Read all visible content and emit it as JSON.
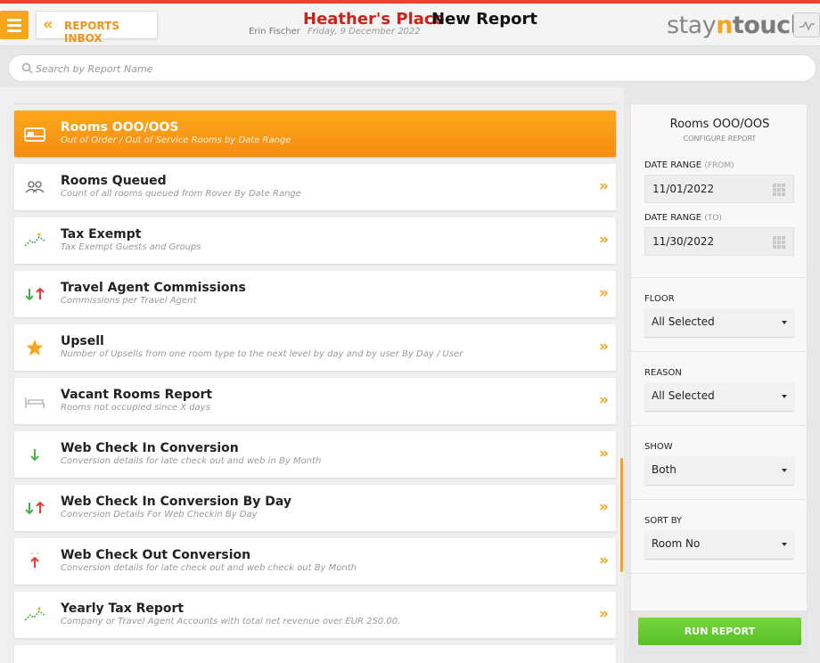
{
  "header": {
    "menu_icon": "hamburger-icon",
    "inbox_label": "REPORTS INBOX",
    "hotel_name": "Heather's Place",
    "page_title": "New Report",
    "user_name": "Erin Fischer",
    "date": "Friday, 9 December 2022",
    "logo_stay": "stay",
    "logo_n": "n",
    "logo_touch": "touch",
    "colors": {
      "accent": "#f7a41d",
      "hotel": "#c8241b",
      "topline": "#e8452f"
    }
  },
  "search": {
    "placeholder": "Search by Report Name",
    "value": ""
  },
  "reports": [
    {
      "title": "Rooms OOO/OOS",
      "desc": "Out of Order / Out of Service Rooms by Date Range",
      "icon": "bed-icon",
      "active": true
    },
    {
      "title": "Rooms Queued",
      "desc": "Count of all rooms queued from Rover By Date Range",
      "icon": "guests-icon",
      "active": false
    },
    {
      "title": "Tax Exempt",
      "desc": "Tax Exempt Guests and Groups",
      "icon": "trend-icon",
      "active": false
    },
    {
      "title": "Travel Agent Commissions",
      "desc": "Commissions per Travel Agent",
      "icon": "up-down-arrows-icon",
      "active": false
    },
    {
      "title": "Upsell",
      "desc": "Number of Upsells from one room type to the next level by day and by user By Day / User",
      "icon": "star-icon",
      "active": false
    },
    {
      "title": "Vacant Rooms Report",
      "desc": "Rooms not occupied since X days",
      "icon": "bed-icon",
      "active": false
    },
    {
      "title": "Web Check In Conversion",
      "desc": "Conversion details for late check out and web in By Month",
      "icon": "down-arrow-icon",
      "active": false
    },
    {
      "title": "Web Check In Conversion By Day",
      "desc": "Conversion Details For Web Checkin By Day",
      "icon": "up-down-arrows-icon",
      "active": false
    },
    {
      "title": "Web Check Out Conversion",
      "desc": "Conversion details for late check out and web check out By Month",
      "icon": "up-arrow-icon",
      "active": false
    },
    {
      "title": "Yearly Tax Report",
      "desc": "Company or Travel Agent Accounts with total net revenue over EUR 250.00.",
      "icon": "trend-icon",
      "active": false
    }
  ],
  "config": {
    "title": "Rooms OOO/OOS",
    "subtitle": "CONFIGURE REPORT",
    "from_label": "DATE RANGE",
    "from_hint": "(FROM)",
    "from_value": "11/01/2022",
    "to_label": "DATE RANGE",
    "to_hint": "(TO)",
    "to_value": "11/30/2022",
    "floor_label": "FLOOR",
    "floor_value": "All Selected",
    "reason_label": "REASON",
    "reason_value": "All Selected",
    "show_label": "SHOW",
    "show_value": "Both",
    "sort_label": "SORT BY",
    "sort_value": "Room No",
    "run_label": "RUN REPORT"
  }
}
